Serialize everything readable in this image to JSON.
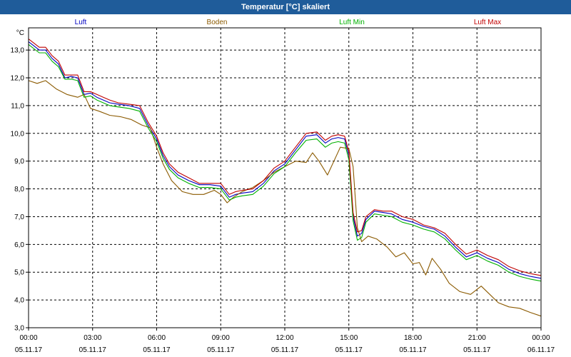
{
  "chart_data": {
    "type": "line",
    "title": "Temperatur [°C] skaliert",
    "yunit": "°C",
    "ylim": [
      3.0,
      13.8
    ],
    "yticks": [
      "3,0",
      "4,0",
      "5,0",
      "6,0",
      "7,0",
      "8,0",
      "9,0",
      "10,0",
      "11,0",
      "12,0",
      "13,0"
    ],
    "ytick_values": [
      3,
      4,
      5,
      6,
      7,
      8,
      9,
      10,
      11,
      12,
      13
    ],
    "xlim": [
      0,
      24
    ],
    "xticks": [
      {
        "time": "00:00",
        "date": "05.11.17",
        "h": 0
      },
      {
        "time": "03:00",
        "date": "05.11.17",
        "h": 3
      },
      {
        "time": "06:00",
        "date": "05.11.17",
        "h": 6
      },
      {
        "time": "09:00",
        "date": "05.11.17",
        "h": 9
      },
      {
        "time": "12:00",
        "date": "05.11.17",
        "h": 12
      },
      {
        "time": "15:00",
        "date": "05.11.17",
        "h": 15
      },
      {
        "time": "18:00",
        "date": "05.11.17",
        "h": 18
      },
      {
        "time": "21:00",
        "date": "05.11.17",
        "h": 21
      },
      {
        "time": "00:00",
        "date": "06.11.17",
        "h": 24
      }
    ],
    "grid": true,
    "legend_position": "top",
    "series": [
      {
        "name": "Luft",
        "color": "#0000c0",
        "x": [
          0,
          0.5,
          0.8,
          1.1,
          1.4,
          1.7,
          2.0,
          2.3,
          2.6,
          2.9,
          3.2,
          3.5,
          3.8,
          4.2,
          4.7,
          5.2,
          5.6,
          6.0,
          6.3,
          6.6,
          7.0,
          7.5,
          8.0,
          8.5,
          9.0,
          9.4,
          9.7,
          10.0,
          10.5,
          11.0,
          11.5,
          12.0,
          12.5,
          13.0,
          13.5,
          13.9,
          14.2,
          14.5,
          14.8,
          15.0,
          15.2,
          15.4,
          15.6,
          15.8,
          16.2,
          16.6,
          17.0,
          17.5,
          18.0,
          18.5,
          19.0,
          19.5,
          20.0,
          20.5,
          21.0,
          21.5,
          22.0,
          22.5,
          23.0,
          23.5,
          24.0
        ],
        "y": [
          13.3,
          13.0,
          13.0,
          12.7,
          12.5,
          12.0,
          12.05,
          12.0,
          11.4,
          11.45,
          11.3,
          11.2,
          11.1,
          11.05,
          11.0,
          10.9,
          10.3,
          9.8,
          9.2,
          8.8,
          8.5,
          8.3,
          8.15,
          8.15,
          8.1,
          7.7,
          7.8,
          7.85,
          7.9,
          8.2,
          8.65,
          8.9,
          9.4,
          9.9,
          9.95,
          9.65,
          9.8,
          9.85,
          9.8,
          9.2,
          7.0,
          6.3,
          6.4,
          6.9,
          7.2,
          7.15,
          7.1,
          6.9,
          6.8,
          6.65,
          6.55,
          6.3,
          5.9,
          5.55,
          5.7,
          5.5,
          5.35,
          5.1,
          4.95,
          4.85,
          4.78
        ]
      },
      {
        "name": "Boden",
        "color": "#8b5a00",
        "x": [
          0,
          0.4,
          0.8,
          1.3,
          1.8,
          2.3,
          2.6,
          2.9,
          3.3,
          3.8,
          4.3,
          4.8,
          5.3,
          5.7,
          6.0,
          6.3,
          6.7,
          7.2,
          7.7,
          8.2,
          8.7,
          9.0,
          9.3,
          9.6,
          10.0,
          10.5,
          11.0,
          11.5,
          12.0,
          12.5,
          13.0,
          13.3,
          13.6,
          14.0,
          14.3,
          14.6,
          15.0,
          15.2,
          15.4,
          15.6,
          15.9,
          16.3,
          16.8,
          17.2,
          17.6,
          18.0,
          18.3,
          18.6,
          18.9,
          19.3,
          19.7,
          20.2,
          20.7,
          21.2,
          21.6,
          22.0,
          22.5,
          23.0,
          23.5,
          24.0
        ],
        "y": [
          11.9,
          11.8,
          11.9,
          11.6,
          11.4,
          11.3,
          11.4,
          10.9,
          10.8,
          10.65,
          10.6,
          10.5,
          10.3,
          10.2,
          9.5,
          8.9,
          8.3,
          7.9,
          7.8,
          7.8,
          7.95,
          7.8,
          7.5,
          7.7,
          7.9,
          8.05,
          8.3,
          8.6,
          8.8,
          9.0,
          8.95,
          9.3,
          9.0,
          8.5,
          9.0,
          9.5,
          9.45,
          8.8,
          6.6,
          6.1,
          6.3,
          6.2,
          5.9,
          5.55,
          5.7,
          5.3,
          5.35,
          4.9,
          5.5,
          5.1,
          4.6,
          4.3,
          4.2,
          4.5,
          4.2,
          3.9,
          3.75,
          3.7,
          3.55,
          3.42
        ]
      },
      {
        "name": "Luft Min",
        "color": "#00b000",
        "x": [
          0,
          0.5,
          0.8,
          1.1,
          1.4,
          1.7,
          2.0,
          2.3,
          2.6,
          2.9,
          3.2,
          3.5,
          3.8,
          4.2,
          4.7,
          5.2,
          5.6,
          6.0,
          6.3,
          6.6,
          7.0,
          7.5,
          8.0,
          8.5,
          9.0,
          9.4,
          9.7,
          10.0,
          10.5,
          11.0,
          11.5,
          12.0,
          12.5,
          13.0,
          13.5,
          13.9,
          14.2,
          14.5,
          14.8,
          15.0,
          15.2,
          15.4,
          15.6,
          15.8,
          16.2,
          16.6,
          17.0,
          17.5,
          18.0,
          18.5,
          19.0,
          19.5,
          20.0,
          20.5,
          21.0,
          21.5,
          22.0,
          22.5,
          23.0,
          23.5,
          24.0
        ],
        "y": [
          13.2,
          12.9,
          12.9,
          12.6,
          12.4,
          11.95,
          11.95,
          11.9,
          11.3,
          11.35,
          11.2,
          11.1,
          11.0,
          10.95,
          10.9,
          10.8,
          10.2,
          9.7,
          9.1,
          8.7,
          8.4,
          8.2,
          8.05,
          8.05,
          8.0,
          7.6,
          7.7,
          7.75,
          7.8,
          8.1,
          8.55,
          8.8,
          9.3,
          9.75,
          9.8,
          9.5,
          9.65,
          9.7,
          9.65,
          9.05,
          6.85,
          6.15,
          6.25,
          6.8,
          7.1,
          7.05,
          7.0,
          6.8,
          6.7,
          6.55,
          6.45,
          6.2,
          5.8,
          5.45,
          5.6,
          5.4,
          5.25,
          5.0,
          4.85,
          4.75,
          4.68
        ]
      },
      {
        "name": "Luft Max",
        "color": "#c00000",
        "x": [
          0,
          0.5,
          0.8,
          1.1,
          1.4,
          1.7,
          2.0,
          2.3,
          2.6,
          2.9,
          3.2,
          3.5,
          3.8,
          4.2,
          4.7,
          5.2,
          5.6,
          6.0,
          6.3,
          6.6,
          7.0,
          7.5,
          8.0,
          8.5,
          9.0,
          9.4,
          9.7,
          10.0,
          10.5,
          11.0,
          11.5,
          12.0,
          12.5,
          13.0,
          13.5,
          13.9,
          14.2,
          14.5,
          14.8,
          15.0,
          15.2,
          15.4,
          15.6,
          15.8,
          16.2,
          16.6,
          17.0,
          17.5,
          18.0,
          18.5,
          19.0,
          19.5,
          20.0,
          20.5,
          21.0,
          21.5,
          22.0,
          22.5,
          23.0,
          23.5,
          24.0
        ],
        "y": [
          13.4,
          13.1,
          13.1,
          12.8,
          12.6,
          12.1,
          12.1,
          12.1,
          11.5,
          11.5,
          11.4,
          11.3,
          11.2,
          11.1,
          11.05,
          11.0,
          10.4,
          9.9,
          9.3,
          8.9,
          8.6,
          8.4,
          8.2,
          8.2,
          8.2,
          7.8,
          7.9,
          7.95,
          8.0,
          8.3,
          8.75,
          9.0,
          9.5,
          10.0,
          10.05,
          9.75,
          9.9,
          9.95,
          9.9,
          9.35,
          7.15,
          6.45,
          6.5,
          7.0,
          7.25,
          7.2,
          7.2,
          7.0,
          6.9,
          6.7,
          6.6,
          6.4,
          6.0,
          5.65,
          5.8,
          5.6,
          5.45,
          5.2,
          5.05,
          4.95,
          4.88
        ]
      }
    ]
  }
}
